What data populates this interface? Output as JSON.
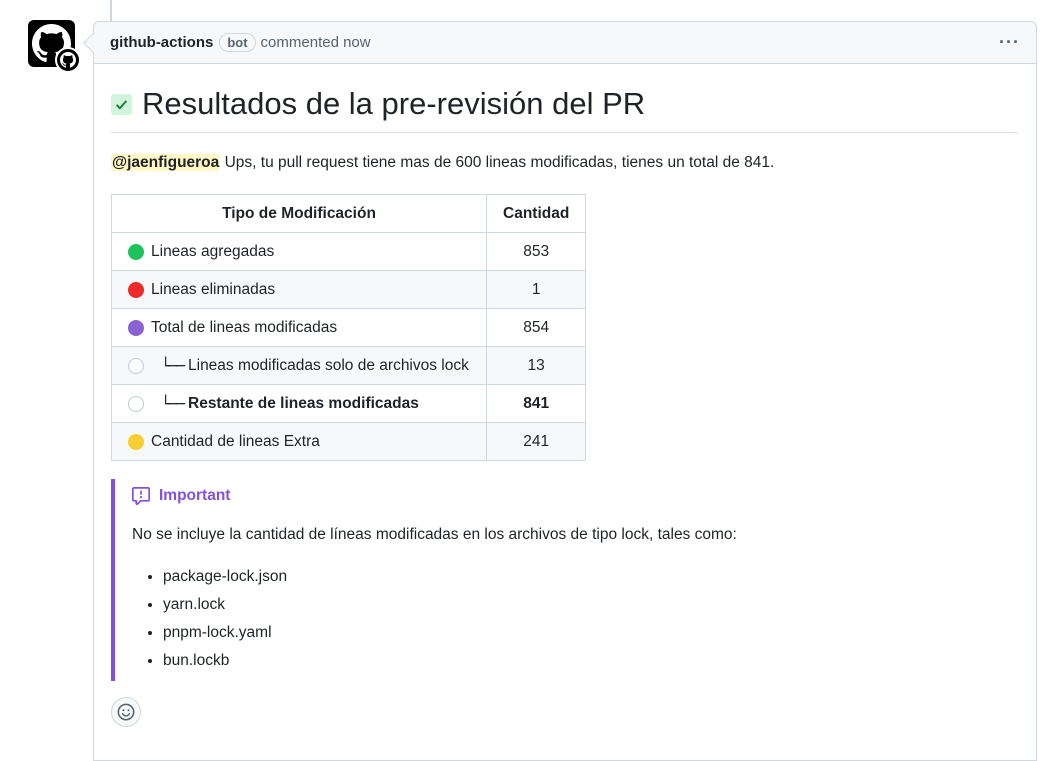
{
  "comment": {
    "author": "github-actions",
    "badge": "bot",
    "meta": "commented now",
    "more": "···"
  },
  "body": {
    "heading": "Resultados de la pre-revisión del PR",
    "mention": "@jaenfigueroa",
    "intro": " Ups, tu pull request tiene mas de 600 lineas modificadas, tienes un total de 841."
  },
  "table": {
    "headers": [
      "Tipo de Modificación",
      "Cantidad"
    ],
    "rows": [
      {
        "label": "Lineas agregadas",
        "value": "853",
        "dot": "#1fc15a"
      },
      {
        "label": "Lineas eliminadas",
        "value": "1",
        "dot": "#ee2b2b"
      },
      {
        "label": "Total de lineas modificadas",
        "value": "854",
        "dot": "#8a63d2"
      },
      {
        "label": "Lineas modificadas solo de archivos lock",
        "value": "13",
        "tree": "└──"
      },
      {
        "label": "Restante de lineas modificadas",
        "value": "841",
        "tree": "└──"
      },
      {
        "label": "Cantidad de lineas Extra",
        "value": "241",
        "dot": "#f7ce32"
      }
    ]
  },
  "alert": {
    "title": "Important",
    "text": "No se incluye la cantidad de líneas modificadas en los archivos de tipo lock, tales como:",
    "items": [
      "package-lock.json",
      "yarn.lock",
      "pnpm-lock.yaml",
      "bun.lockb"
    ]
  }
}
